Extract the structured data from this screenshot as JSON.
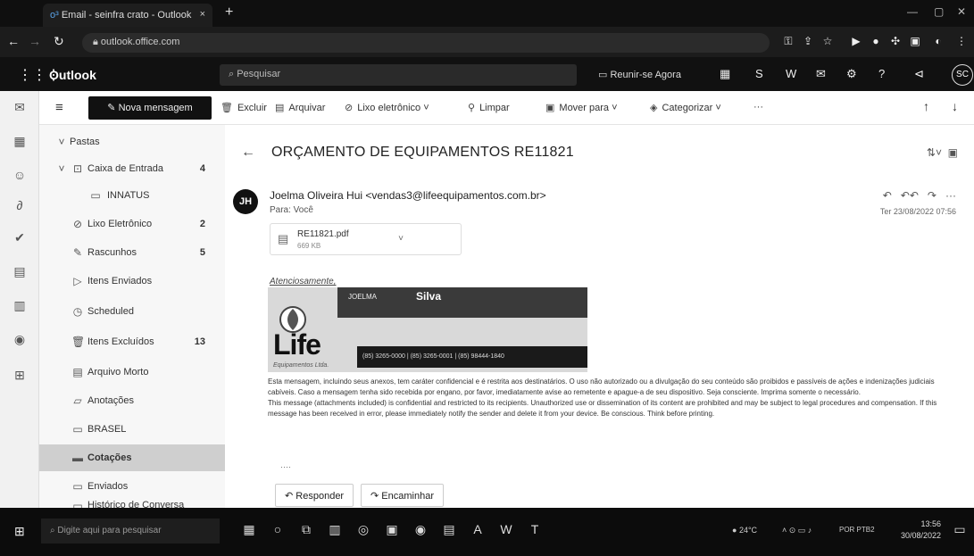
{
  "browser": {
    "tab_title": "Email - seinfra crato - Outlook",
    "tab_close": "×",
    "new_tab": "+",
    "url": "outlook.office.com"
  },
  "outlook": {
    "brand": "Outlook",
    "search_placeholder": "Pesquisar",
    "meet_now": "Reunir-se Agora",
    "avatar_initials": "SC"
  },
  "toolbar": {
    "new_message": "Nova mensagem",
    "delete": "Excluir",
    "archive": "Arquivar",
    "junk": "Lixo eletrônico",
    "sweep": "Limpar",
    "move_to": "Mover para",
    "categorize": "Categorizar",
    "more": "···"
  },
  "folders": {
    "header": "Pastas",
    "items": [
      {
        "label": "Caixa de Entrada",
        "count": "4"
      },
      {
        "label": "INNATUS",
        "count": ""
      },
      {
        "label": "Lixo Eletrônico",
        "count": "2"
      },
      {
        "label": "Rascunhos",
        "count": "5"
      },
      {
        "label": "Itens Enviados",
        "count": ""
      },
      {
        "label": "Scheduled",
        "count": ""
      },
      {
        "label": "Itens Excluídos",
        "count": "13"
      },
      {
        "label": "Arquivo Morto",
        "count": ""
      },
      {
        "label": "Anotações",
        "count": ""
      },
      {
        "label": "BRASEL",
        "count": ""
      },
      {
        "label": "Cotações",
        "count": ""
      },
      {
        "label": "Enviados",
        "count": ""
      },
      {
        "label": "Histórico de Conversa",
        "count": ""
      }
    ]
  },
  "message": {
    "subject": "ORÇAMENTO DE EQUIPAMENTOS RE11821",
    "sender_initials": "JH",
    "sender": "Joelma Oliveira Hui <vendas3@lifeequipamentos.com.br>",
    "to": "Para: Você",
    "date": "Ter 23/08/2022 07:56",
    "attachment_name": "RE11821.pdf",
    "attachment_size": "669 KB",
    "regards": "Atenciosamente,",
    "signature": {
      "name_label": "JOELMA",
      "name": "Silva",
      "brand": "Life",
      "contact": "(85) 3265-0000  |  (85) 3265-0001  |  (85) 98444-1840",
      "tagline": "Equipamentos Ltda."
    },
    "disclaimer_pt": "Esta mensagem, incluindo seus anexos, tem caráter confidencial e é restrita aos destinatários. O uso não autorizado ou a divulgação do seu conteúdo são proibidos e passíveis de ações e indenizações judiciais cabíveis. Caso a mensagem tenha sido recebida por engano, por favor, imediatamente avise ao remetente e apague-a de seu dispositivo. Seja consciente. Imprima somente o necessário.",
    "disclaimer_en": "This message (attachments included) is confidential and restricted to its recipients. Unauthorized use or dissemination of its content are prohibited and may be subject to legal procedures and compensation. If this message has been received in error, please immediately notify the sender and delete it from your device. Be conscious. Think before printing.",
    "ellipsis": "····",
    "reply": "Responder",
    "forward": "Encaminhar"
  },
  "taskbar": {
    "search_placeholder": "Digite aqui para pesquisar",
    "weather": "24°C",
    "lang": "POR PTB2",
    "time": "13:56",
    "date": "30/08/2022"
  }
}
